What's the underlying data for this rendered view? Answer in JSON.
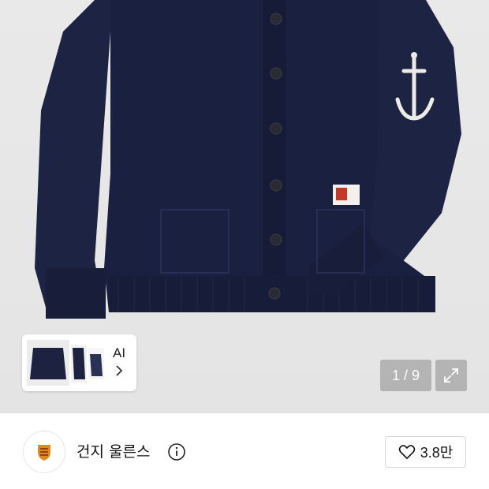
{
  "gallery": {
    "thumbnail_badge": {
      "label": "AI",
      "chevron_icon": "chevron-right-icon"
    },
    "counter": "1 / 9",
    "expand_icon": "expand-icon"
  },
  "brand": {
    "name": "건지 울른스",
    "logo_icon": "brand-crest-icon",
    "info_icon": "info-icon"
  },
  "like": {
    "count": "3.8만",
    "icon": "heart-icon"
  },
  "colors": {
    "garment": "#1c2240",
    "gallery_bg": "#e7e7e7",
    "overlay": "#8a8a8a"
  }
}
